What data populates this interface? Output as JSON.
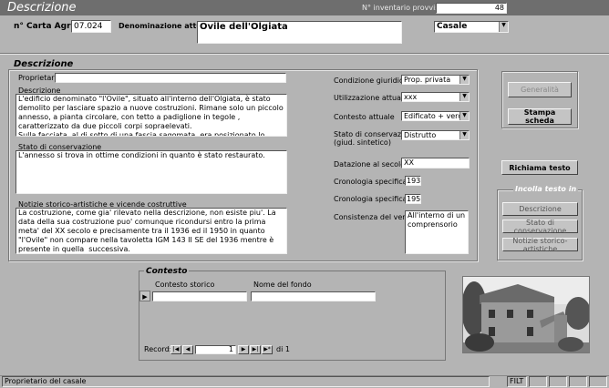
{
  "header": {
    "title": "Descrizione",
    "inventory_label": "N° inventario provvisorio",
    "inventory_value": "48"
  },
  "top": {
    "carta_label": "n° Carta Agro",
    "carta_value": "07.024",
    "denominazione_label": "Denominazione attuale",
    "denominazione_value": "Ovile dell'Olgiata",
    "tipo_value": "Casale"
  },
  "descrizione": {
    "section_title": "Descrizione",
    "proprietario_label": "Proprietario",
    "proprietario_value": "",
    "descrizione_label": "Descrizione",
    "descrizione_text": "L'edificio denominato \"l'Ovile\", situato all'interno dell'Olgiata, è stato demolito per lasciare spazio a nuove costruzioni. Rimane solo un piccolo annesso, a pianta circolare, con tetto a padiglione in tegole , caratterizzato da due piccoli corpi sopraelevati.\nSulla facciata, al di sotto di una fascia sagomata, era posizionato lo stemma dell'Olgiata con stella ad otto punte che attualmente non si trova piu' nella sua collocazione originaria.\nTale struttura possedeva sulla fronte, una vasca di forma semicircolare oggi non piu'",
    "stato_label": "Stato di conservazione",
    "stato_text": "L'annesso si trova in ottime condizioni in quanto è stato restaurato.",
    "notizie_label": "Notizie storico-artistiche e vicende costruttive",
    "notizie_text": "La costruzione, come gia' rilevato nella descrizione, non esiste piu'. La data della sua costruzione puo' comunque ricondursi entro la prima meta' del XX secolo e precisamente tra il 1936 ed il 1950 in quanto \"l'Ovile\" non compare nella tavoletta IGM 143 II SE del 1936 mentre è presente in quella  successiva.\nA tale periodo puo' rapportarsi l'annesso ancor oggi visibile."
  },
  "props": {
    "condizione_label": "Condizione giuridica",
    "condizione_value": "Prop. privata",
    "utilizzazione_label": "Utilizzazione attuale",
    "utilizzazione_value": "xxx",
    "contesto_label": "Contesto attuale",
    "contesto_value": "Edificato + verde",
    "stato_cons_label": "Stato di conservazione\n(giud. sintetico)",
    "stato_cons_value": "Distrutto",
    "datazione_label": "Datazione al secolo:",
    "datazione_value": "XX",
    "cron_da_label": "Cronologia specifica da",
    "cron_da_value": "1936",
    "cron_a_label": "Cronologia specifica a",
    "cron_a_value": "1950",
    "verde_label": "Consistenza del verde:",
    "verde_value": "All'interno di un comprensorio"
  },
  "buttons": {
    "generalita": "Generalità",
    "stampa": "Stampa scheda",
    "richiama": "Richiama testo",
    "incolla_title": "Incolla testo in",
    "descrizione": "Descrizione",
    "stato": "Stato di conservazione",
    "notizie": "Notizie storico-artistiche"
  },
  "contesto": {
    "title": "Contesto",
    "col1": "Contesto storico",
    "col2": "Nome del fondo",
    "record_label": "Record:",
    "record_value": "1",
    "record_total": "di 1"
  },
  "statusbar": {
    "text": "Proprietario del casale",
    "filt": "FILT"
  }
}
